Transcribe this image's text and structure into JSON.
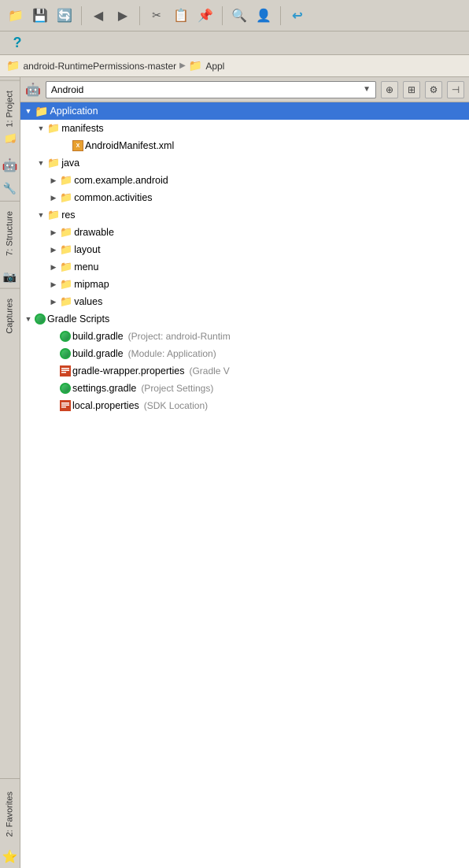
{
  "toolbar": {
    "buttons": [
      {
        "name": "open-folder",
        "icon": "📁"
      },
      {
        "name": "save",
        "icon": "💾"
      },
      {
        "name": "refresh",
        "icon": "🔄"
      },
      {
        "name": "back",
        "icon": "◀"
      },
      {
        "name": "forward",
        "icon": "▶"
      },
      {
        "name": "cut",
        "icon": "✂"
      },
      {
        "name": "copy",
        "icon": "📋"
      },
      {
        "name": "paste",
        "icon": "📌"
      },
      {
        "name": "search",
        "icon": "🔍"
      },
      {
        "name": "user",
        "icon": "👤"
      },
      {
        "name": "import",
        "icon": "↩"
      }
    ],
    "help": "?"
  },
  "breadcrumb": {
    "items": [
      "android-RuntimePermissions-master",
      "Appl"
    ]
  },
  "panel": {
    "dropdown_value": "Android",
    "android_icon": "🤖"
  },
  "sidebar_tabs": [
    {
      "id": "project",
      "label": "1: Project",
      "icon": "📁"
    },
    {
      "id": "structure",
      "label": "7: Structure",
      "icon": "🏗"
    },
    {
      "id": "captures",
      "label": "Captures",
      "icon": "📷"
    }
  ],
  "tree": {
    "items": [
      {
        "id": "application",
        "label": "Application",
        "type": "folder-orange",
        "expanded": true,
        "indent": 0,
        "selected": true
      },
      {
        "id": "manifests",
        "label": "manifests",
        "type": "folder-blue",
        "expanded": true,
        "indent": 1
      },
      {
        "id": "androidmanifest",
        "label": "AndroidManifest.xml",
        "type": "xml",
        "indent": 2
      },
      {
        "id": "java",
        "label": "java",
        "type": "folder-blue",
        "expanded": true,
        "indent": 1
      },
      {
        "id": "com-example",
        "label": "com.example.android",
        "type": "folder-pkg",
        "expanded": false,
        "indent": 2
      },
      {
        "id": "common-activities",
        "label": "common.activities",
        "type": "folder-pkg",
        "expanded": false,
        "indent": 2
      },
      {
        "id": "res",
        "label": "res",
        "type": "folder-orange",
        "expanded": true,
        "indent": 1
      },
      {
        "id": "drawable",
        "label": "drawable",
        "type": "folder-pkg",
        "expanded": false,
        "indent": 2
      },
      {
        "id": "layout",
        "label": "layout",
        "type": "folder-pkg",
        "expanded": false,
        "indent": 2
      },
      {
        "id": "menu",
        "label": "menu",
        "type": "folder-pkg",
        "expanded": false,
        "indent": 2
      },
      {
        "id": "mipmap",
        "label": "mipmap",
        "type": "folder-pkg",
        "expanded": false,
        "indent": 2
      },
      {
        "id": "values",
        "label": "values",
        "type": "folder-pkg",
        "expanded": false,
        "indent": 2
      }
    ],
    "gradle": {
      "section_label": "Gradle Scripts",
      "expanded": true,
      "indent": 0,
      "files": [
        {
          "id": "build-gradle-proj",
          "label": "build.gradle",
          "sublabel": "(Project: android-Runtim",
          "type": "gradle"
        },
        {
          "id": "build-gradle-app",
          "label": "build.gradle",
          "sublabel": "(Module: Application)",
          "type": "gradle"
        },
        {
          "id": "gradle-wrapper",
          "label": "gradle-wrapper.properties",
          "sublabel": "(Gradle V",
          "type": "props"
        },
        {
          "id": "settings-gradle",
          "label": "settings.gradle",
          "sublabel": "(Project Settings)",
          "type": "gradle"
        },
        {
          "id": "local-properties",
          "label": "local.properties",
          "sublabel": "(SDK Location)",
          "type": "props"
        }
      ]
    }
  },
  "favorites": {
    "label": "2: Favorites",
    "icon": "⭐"
  }
}
